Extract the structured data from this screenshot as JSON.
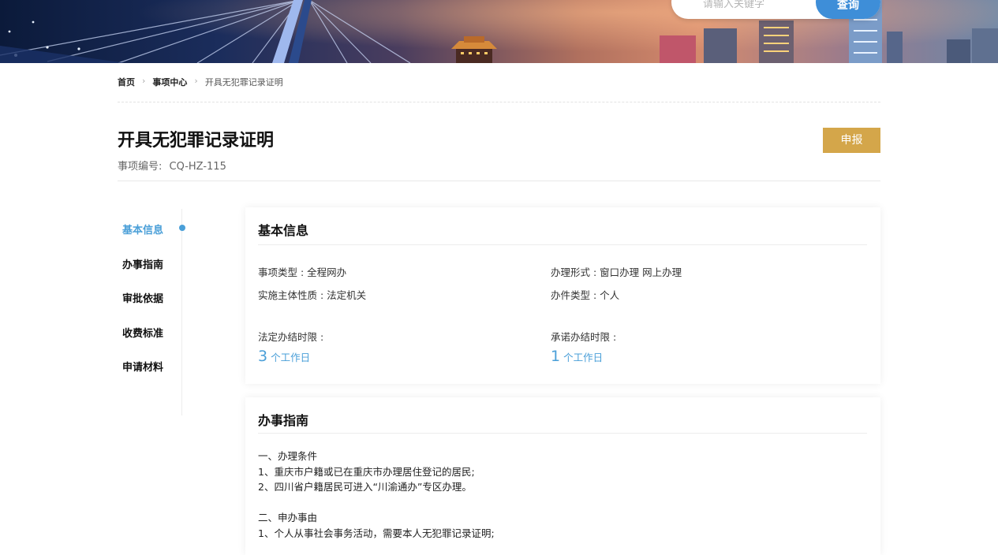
{
  "search": {
    "placeholder": "请输入关键字",
    "button_label": "查询"
  },
  "breadcrumb": {
    "items": [
      "首页",
      "事项中心",
      "开具无犯罪记录证明"
    ],
    "separator": "›"
  },
  "header": {
    "title": "开具无犯罪记录证明",
    "code_label": "事项编号:",
    "code_value": "CQ-HZ-115",
    "apply_label": "申报"
  },
  "side_nav": {
    "items": [
      "基本信息",
      "办事指南",
      "审批依据",
      "收费标准",
      "申请材料"
    ],
    "active_index": 0
  },
  "basic_info": {
    "title": "基本信息",
    "fields": {
      "item_type": "事项类型 : 全程网办",
      "handle_form": "办理形式 : 窗口办理 网上办理",
      "subject_nature": "实施主体性质 : 法定机关",
      "case_type": "办件类型 : 个人"
    },
    "legal_limit_label": "法定办结时限 :",
    "legal_limit_value": "3",
    "promise_limit_label": "承诺办结时限 :",
    "promise_limit_value": "1",
    "limit_unit": "个工作日"
  },
  "guide": {
    "title": "办事指南",
    "lines": [
      "一、办理条件",
      "1、重庆市户籍或已在重庆市办理居住登记的居民;",
      "2、四川省户籍居民可进入“川渝通办”专区办理。",
      "",
      "二、申办事由",
      "1、个人从事社会事务活动，需要本人无犯罪记录证明;"
    ]
  },
  "colors": {
    "accent_blue": "#4a9fd8",
    "apply_gold": "#d4a64a",
    "search_button": "#3e8ed8"
  }
}
